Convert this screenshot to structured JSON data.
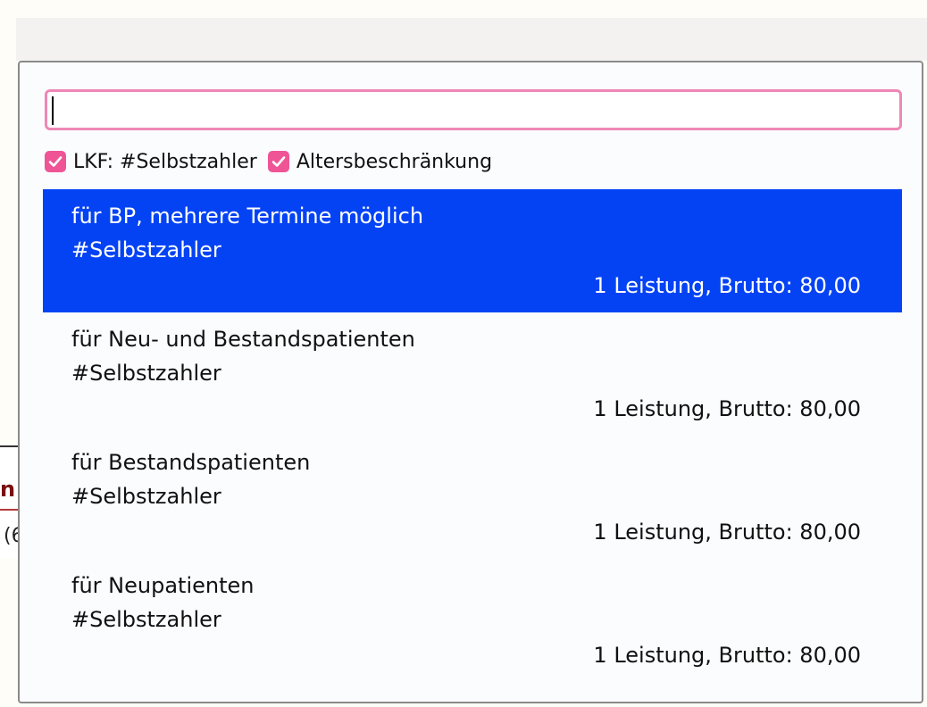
{
  "background": {
    "fragment_1": "n",
    "fragment_2": "(6"
  },
  "search": {
    "value": "",
    "placeholder": ""
  },
  "filters": [
    {
      "label": "LKF: #Selbstzahler",
      "checked": true
    },
    {
      "label": "Altersbeschränkung",
      "checked": true
    }
  ],
  "results": [
    {
      "title": "für BP, mehrere Termine möglich",
      "tag": "#Selbstzahler",
      "summary": "1 Leistung, Brutto: 80,00",
      "selected": true
    },
    {
      "title": "für Neu- und Bestandspatienten",
      "tag": "#Selbstzahler",
      "summary": "1 Leistung, Brutto: 80,00",
      "selected": false
    },
    {
      "title": "für Bestandspatienten",
      "tag": "#Selbstzahler",
      "summary": "1 Leistung, Brutto: 80,00",
      "selected": false
    },
    {
      "title": "für Neupatienten",
      "tag": "#Selbstzahler",
      "summary": "1 Leistung, Brutto: 80,00",
      "selected": false
    }
  ],
  "colors": {
    "accent_pink": "#ef5496",
    "focus_border": "#ef87b6",
    "selected_bg": "#0443f4"
  }
}
